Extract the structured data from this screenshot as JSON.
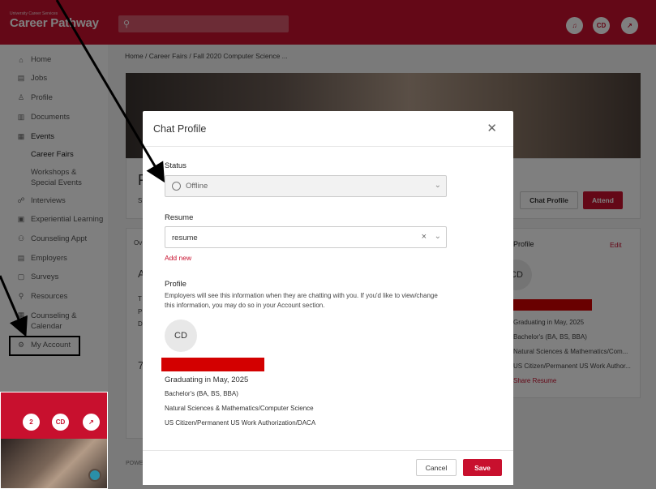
{
  "header": {
    "logo_small": "University Career Services",
    "logo_big": "Career Pathway",
    "search_icon": "search-icon",
    "notifications_icon": "bell-icon",
    "avatar_initials": "CD",
    "external_icon": "external-link-icon"
  },
  "sidebar": {
    "items": [
      {
        "label": "Home",
        "icon": "⌂"
      },
      {
        "label": "Jobs",
        "icon": "▤"
      },
      {
        "label": "Profile",
        "icon": "♙"
      },
      {
        "label": "Documents",
        "icon": "▥"
      },
      {
        "label": "Events",
        "icon": "▦"
      },
      {
        "label": "Interviews",
        "icon": "☍"
      },
      {
        "label": "Experiential Learning",
        "icon": "▣"
      },
      {
        "label": "Counseling Appt",
        "icon": "⚇"
      },
      {
        "label": "Employers",
        "icon": "▤"
      },
      {
        "label": "Surveys",
        "icon": "▢"
      },
      {
        "label": "Resources",
        "icon": "⚲"
      },
      {
        "label": "Counseling & Calendar",
        "icon": "▦"
      },
      {
        "label": "My Account",
        "icon": "⚙"
      }
    ],
    "sub_items": [
      {
        "label": "Career Fairs"
      },
      {
        "label": "Workshops & Special Events"
      }
    ]
  },
  "main": {
    "breadcrumb": "Home / Career Fairs / Fall 2020 Computer Science ...",
    "chat_profile_button": "Chat Profile",
    "attend_button": "Attend",
    "profile_card": {
      "title": "Profile",
      "edit": "Edit",
      "avatar": "CD",
      "lines": [
        "Graduating in May, 2025",
        "Bachelor's (BA, BS, BBA)",
        "Natural Sciences & Mathematics/Com...",
        "US Citizen/Permanent US Work Author...",
        "Share Resume"
      ]
    },
    "left_letters": [
      "F",
      "S",
      "Ov",
      "A",
      "T",
      "P",
      "D",
      "7"
    ],
    "footer_text": "POWE"
  },
  "modal": {
    "title": "Chat Profile",
    "close_icon": "close-icon",
    "status_label": "Status",
    "status_value": "Offline",
    "resume_label": "Resume",
    "resume_value": "resume",
    "add_new": "Add new",
    "profile_label": "Profile",
    "profile_desc": "Employers will see this information when they are chatting with you. If you'd like to view/change this information, you may do so in your Account section.",
    "avatar": "CD",
    "lines": [
      "Graduating in May, 2025",
      "Bachelor's (BA, BS, BBA)",
      "Natural Sciences & Mathematics/Computer Science",
      "US Citizen/Permanent US Work Authorization/DACA"
    ],
    "cancel": "Cancel",
    "save": "Save"
  },
  "zoom_inset": {
    "badge": "2",
    "avatar": "CD",
    "external_icon": "external-link-icon"
  },
  "colors": {
    "brand": "#c8102e",
    "redaction": "#d30000"
  }
}
